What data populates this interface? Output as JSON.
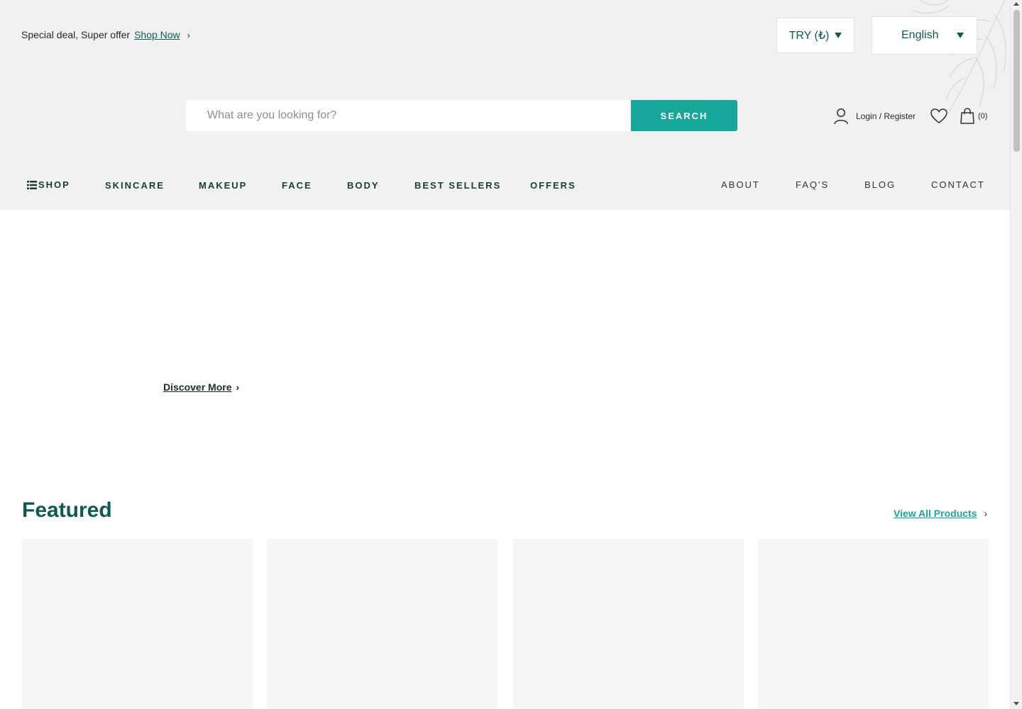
{
  "topbar": {
    "promo_text": "Special deal, Super offer",
    "promo_link": "Shop Now",
    "promo_chevron": "›",
    "currency": "TRY (₺)",
    "language": "English"
  },
  "search": {
    "placeholder": "What are you looking for?",
    "button": "SEARCH"
  },
  "account": {
    "login_register": "Login / Register",
    "cart_count": "(0)"
  },
  "nav": {
    "shop": "SHOP",
    "main": [
      "SKINCARE",
      "MAKEUP",
      "FACE",
      "BODY",
      "BEST SELLERS",
      "OFFERS"
    ],
    "secondary": [
      "ABOUT",
      "FAQ'S",
      "BLOG",
      "CONTACT"
    ]
  },
  "hero": {
    "discover": "Discover More",
    "chevron": "›"
  },
  "featured": {
    "title": "Featured",
    "view_all": "View All Products",
    "chevron": "›"
  },
  "colors": {
    "brand_teal": "#16a79b",
    "brand_dark_green": "#0f5a53",
    "header_bg": "#f1f1f1"
  },
  "icons": [
    "user-icon",
    "heart-icon",
    "shopping-bag-icon",
    "list-menu-icon",
    "chevron-right-icon",
    "dropdown-triangle-icon",
    "leaf-decoration"
  ]
}
